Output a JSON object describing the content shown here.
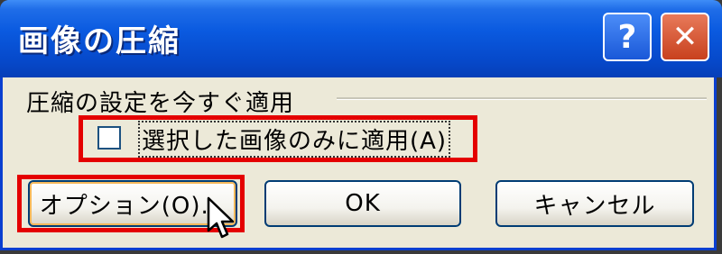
{
  "window": {
    "title": "画像の圧縮",
    "help_label": "?",
    "close_label": "✕"
  },
  "group": {
    "label": "圧縮の設定を今すぐ適用",
    "checkbox_label": "選択した画像のみに適用(A)",
    "checkbox_checked": false
  },
  "buttons": {
    "option_label": "オプション(O)...",
    "ok_label": "OK",
    "cancel_label": "キャンセル"
  },
  "colors": {
    "title_bar": "#0a5ae0",
    "highlight": "#e40000",
    "dialog_bg": "#ece9d8"
  },
  "icons": {
    "help": "question-mark-icon",
    "close": "close-icon",
    "cursor": "mouse-pointer-icon"
  }
}
